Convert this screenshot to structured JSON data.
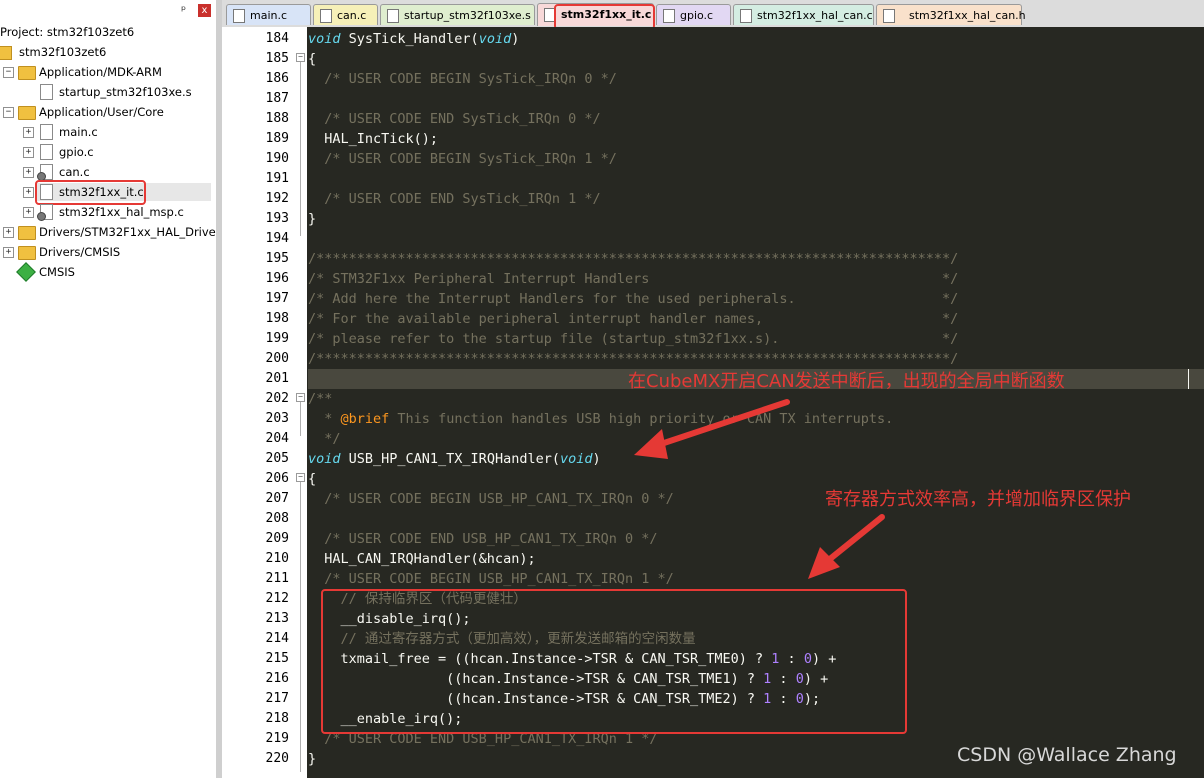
{
  "project_panel": {
    "title": "Project: stm32f103zet6",
    "pin_glyph": "ᵖ",
    "close_glyph": "x",
    "items": [
      {
        "label": "stm32f103zet6"
      },
      {
        "label": "Application/MDK-ARM"
      },
      {
        "label": "startup_stm32f103xe.s"
      },
      {
        "label": "Application/User/Core"
      },
      {
        "label": "main.c"
      },
      {
        "label": "gpio.c"
      },
      {
        "label": "can.c"
      },
      {
        "label": "stm32f1xx_it.c"
      },
      {
        "label": "stm32f1xx_hal_msp.c"
      },
      {
        "label": "Drivers/STM32F1xx_HAL_Driver"
      },
      {
        "label": "Drivers/CMSIS"
      },
      {
        "label": "CMSIS"
      }
    ]
  },
  "tabs": [
    {
      "label": "main.c",
      "color": "#d8e4f7"
    },
    {
      "label": "can.c",
      "color": "#f6f0b8"
    },
    {
      "label": "startup_stm32f103xe.s",
      "color": "#dfeecf"
    },
    {
      "label": "stm32f1xx_it.c",
      "color": "#f8d9d9"
    },
    {
      "label": "gpio.c",
      "color": "#e2d8f3"
    },
    {
      "label": "stm32f1xx_hal_can.c",
      "color": "#d4ede2"
    },
    {
      "label": "stm32f1xx_hal_can.h",
      "color": "#f9e1cb"
    }
  ],
  "editor": {
    "line_numbers": [
      "184",
      "185",
      "186",
      "187",
      "188",
      "189",
      "190",
      "191",
      "192",
      "193",
      "194",
      "195",
      "196",
      "197",
      "198",
      "199",
      "200",
      "201",
      "202",
      "203",
      "204",
      "205",
      "206",
      "207",
      "208",
      "209",
      "210",
      "211",
      "212",
      "213",
      "214",
      "215",
      "216",
      "217",
      "218",
      "219",
      "220"
    ],
    "code": {
      "l184_kw": "void",
      "l184_rest": " SysTick_Handler(",
      "l184_kw2": "void",
      "l184_end": ")",
      "l185": "{",
      "l186": "  /* USER CODE BEGIN SysTick_IRQn 0 */",
      "l188": "  /* USER CODE END SysTick_IRQn 0 */",
      "l189": "  HAL_IncTick();",
      "l190": "  /* USER CODE BEGIN SysTick_IRQn 1 */",
      "l192": "  /* USER CODE END SysTick_IRQn 1 */",
      "l193": "}",
      "l195": "/******************************************************************************/",
      "l196": "/* STM32F1xx Peripheral Interrupt Handlers                                    */",
      "l197": "/* Add here the Interrupt Handlers for the used peripherals.                  */",
      "l198": "/* For the available peripheral interrupt handler names,                      */",
      "l199": "/* please refer to the startup file (startup_stm32f1xx.s).                    */",
      "l200": "/******************************************************************************/",
      "l202": "/**",
      "l203_a": "  * ",
      "l203_tag": "@brief",
      "l203_b": " This function handles USB high priority or CAN TX interrupts.",
      "l204": "  */",
      "l205_kw": "void",
      "l205_rest": " USB_HP_CAN1_TX_IRQHandler(",
      "l205_kw2": "void",
      "l205_end": ")",
      "l206": "{",
      "l207": "  /* USER CODE BEGIN USB_HP_CAN1_TX_IRQn 0 */",
      "l209": "  /* USER CODE END USB_HP_CAN1_TX_IRQn 0 */",
      "l210": "  HAL_CAN_IRQHandler(&hcan);",
      "l211": "  /* USER CODE BEGIN USB_HP_CAN1_TX_IRQn 1 */",
      "l212": "    // 保持临界区（代码更健壮）",
      "l213": "    __disable_irq();",
      "l214": "    // 通过寄存器方式（更加高效），更新发送邮箱的空闲数量",
      "l215_a": "    txmail_free = ((hcan.Instance->TSR & CAN_TSR_TME0) ? ",
      "l215_n1": "1",
      "l215_b": " : ",
      "l215_n2": "0",
      "l215_c": ") +",
      "l216_a": "                 ((hcan.Instance->TSR & CAN_TSR_TME1) ? ",
      "l216_n1": "1",
      "l216_b": " : ",
      "l216_n2": "0",
      "l216_c": ") +",
      "l217_a": "                 ((hcan.Instance->TSR & CAN_TSR_TME2) ? ",
      "l217_n1": "1",
      "l217_b": " : ",
      "l217_n2": "0",
      "l217_c": ");",
      "l218": "    __enable_irq();",
      "l219": "  /* USER CODE END USB_HP_CAN1_TX_IRQn 1 */",
      "l220": "}"
    }
  },
  "annotations": {
    "top": "在CubeMX开启CAN发送中断后，出现的全局中断函数",
    "bottom": "寄存器方式效率高，并增加临界区保护"
  },
  "watermark": "CSDN @Wallace Zhang",
  "colors": {
    "highlight": "#e53935",
    "editor_bg": "#272822"
  }
}
